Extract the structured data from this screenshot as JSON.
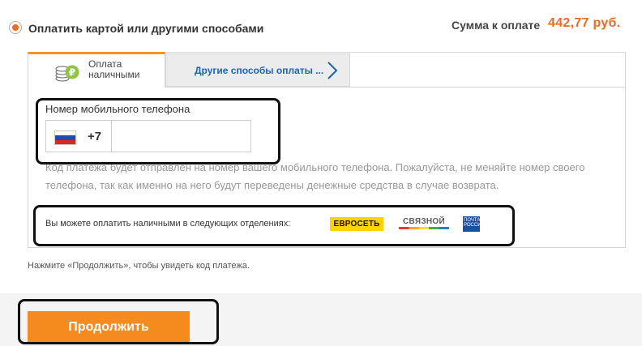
{
  "payment_option": {
    "label": "Оплатить картой или другими способами",
    "selected": true
  },
  "sum": {
    "label": "Сумма к оплате",
    "value": "442,77 руб."
  },
  "tabs": [
    {
      "label_line1": "Оплата",
      "label_line2": "наличными",
      "icon": "coins-ruble-icon",
      "active": true
    },
    {
      "label": "Другие способы оплаты ...",
      "icon": "chevron-right-icon",
      "active": false
    }
  ],
  "phone": {
    "label": "Номер мобильного телефона",
    "country_flag": "russia-flag-icon",
    "country_code": "+7",
    "value": "",
    "placeholder": ""
  },
  "hint": "Код платежа будет отправлен на номер вашего мобильного телефона. Пожалуйста, не меняйте номер своего телефона, так как именно на него будут переведены денежные средства в случае возврата.",
  "partners": {
    "text": "Вы можете оплатить наличными в следующих отделениях:",
    "logos": [
      {
        "name": "euroset-logo",
        "text": "ЕВРОСЕТЬ"
      },
      {
        "name": "svyaznoy-logo",
        "text": "СВЯЗНОЙ"
      },
      {
        "name": "russian-post-logo",
        "text": "ПОЧТА РОССИИ"
      }
    ]
  },
  "footer_hint": "Нажмите «Продолжить», чтобы увидеть код платежа.",
  "continue_button": "Продолжить",
  "colors": {
    "accent": "#f26a1b",
    "button": "#f58a1f",
    "tab_top": "#f7941d",
    "link": "#1b63b8",
    "hint": "#999999"
  }
}
